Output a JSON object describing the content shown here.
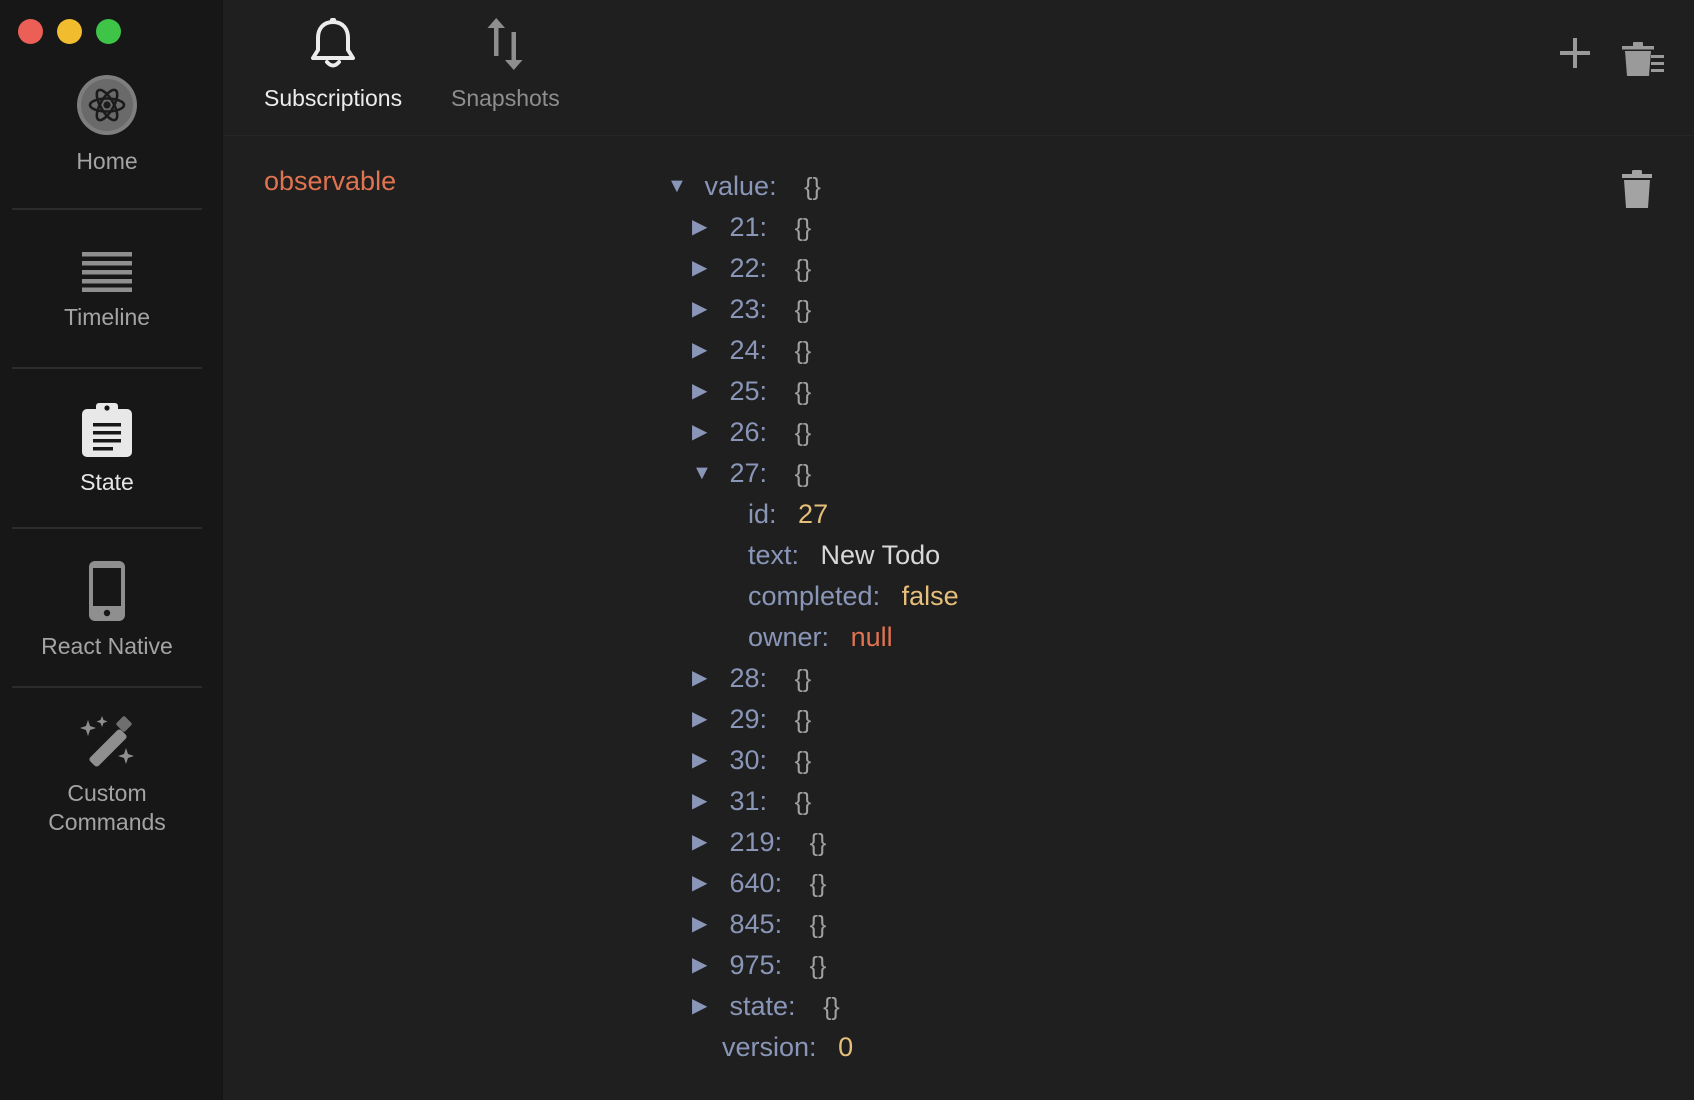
{
  "window": {
    "traffic_lights": [
      "close",
      "minimize",
      "zoom"
    ]
  },
  "sidebar": {
    "items": [
      {
        "label": "Home",
        "icon": "react-atom-icon",
        "active": false
      },
      {
        "label": "Timeline",
        "icon": "timeline-lines-icon",
        "active": false
      },
      {
        "label": "State",
        "icon": "clipboard-icon",
        "active": true
      },
      {
        "label": "React Native",
        "icon": "phone-icon",
        "active": false
      },
      {
        "label": "Custom\nCommands",
        "icon": "magic-wand-icon",
        "active": false
      }
    ]
  },
  "header": {
    "tabs": [
      {
        "label": "Subscriptions",
        "icon": "bell-icon",
        "active": true
      },
      {
        "label": "Snapshots",
        "icon": "up-down-arrows-icon",
        "active": false
      }
    ],
    "actions": [
      {
        "name": "add-subscription",
        "icon": "plus-icon"
      },
      {
        "name": "clear-all-subscriptions",
        "icon": "trash-list-icon"
      }
    ]
  },
  "subscription": {
    "name": "observable",
    "tree": {
      "root_key": "value:",
      "root_brace": "{}",
      "before": [
        {
          "key": "21:",
          "brace": "{}"
        },
        {
          "key": "22:",
          "brace": "{}"
        },
        {
          "key": "23:",
          "brace": "{}"
        },
        {
          "key": "24:",
          "brace": "{}"
        },
        {
          "key": "25:",
          "brace": "{}"
        },
        {
          "key": "26:",
          "brace": "{}"
        }
      ],
      "expanded": {
        "key": "27:",
        "brace": "{}",
        "fields": {
          "id_key": "id:",
          "id_val": "27",
          "text_key": "text:",
          "text_val": "New Todo",
          "completed_key": "completed:",
          "completed_val": "false",
          "owner_key": "owner:",
          "owner_val": "null"
        }
      },
      "after": [
        {
          "key": "28:",
          "brace": "{}"
        },
        {
          "key": "29:",
          "brace": "{}"
        },
        {
          "key": "30:",
          "brace": "{}"
        },
        {
          "key": "31:",
          "brace": "{}"
        },
        {
          "key": "219:",
          "brace": "{}"
        },
        {
          "key": "640:",
          "brace": "{}"
        },
        {
          "key": "845:",
          "brace": "{}"
        },
        {
          "key": "975:",
          "brace": "{}"
        },
        {
          "key": "state:",
          "brace": "{}"
        }
      ],
      "version_key": "version:",
      "version_val": "0"
    }
  },
  "colors": {
    "background": "#1f1f1f",
    "sidebar": "#171717",
    "key": "#8a96b8",
    "number": "#e6bf7a",
    "null": "#e07350",
    "subscription_name": "#e07350"
  }
}
